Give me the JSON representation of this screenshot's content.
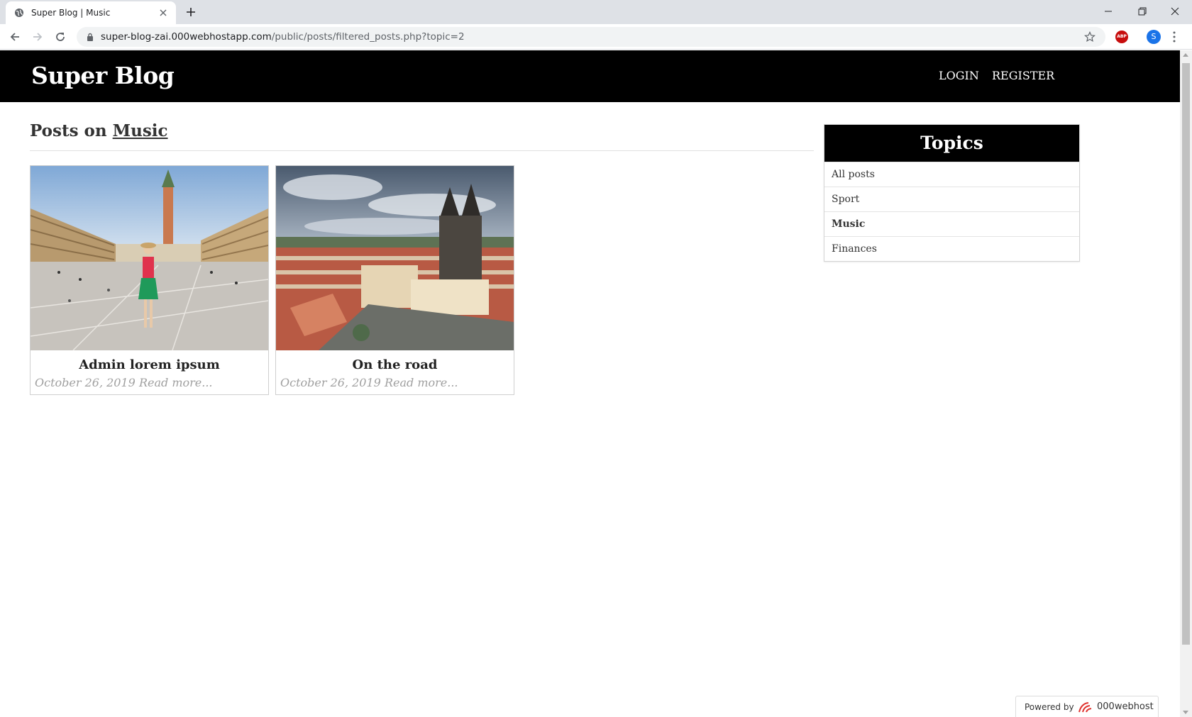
{
  "browser": {
    "tab_title": "Super Blog | Music",
    "url_host": "super-blog-zai.000webhostapp.com",
    "url_path": "/public/posts/filtered_posts.php?topic=2",
    "profile_initial": "S",
    "extension_badge": "ABP"
  },
  "header": {
    "logo": "Super Blog",
    "nav": {
      "login": "LOGIN",
      "register": "REGISTER"
    }
  },
  "main": {
    "heading_prefix": "Posts on",
    "heading_topic": "Music",
    "posts": [
      {
        "title": "Admin lorem ipsum",
        "date": "October 26, 2019",
        "read_more": "Read more..."
      },
      {
        "title": "On the road",
        "date": "October 26, 2019",
        "read_more": "Read more..."
      }
    ]
  },
  "sidebar": {
    "title": "Topics",
    "items": [
      {
        "label": "All posts",
        "active": false
      },
      {
        "label": "Sport",
        "active": false
      },
      {
        "label": "Music",
        "active": true
      },
      {
        "label": "Finances",
        "active": false
      }
    ]
  },
  "footer_badge": {
    "powered_by": "Powered by",
    "brand": "000webhost"
  },
  "colors": {
    "header_bg": "#000000",
    "text": "#333333",
    "meta": "#a0a0a0",
    "brand_red": "#e0332f"
  }
}
